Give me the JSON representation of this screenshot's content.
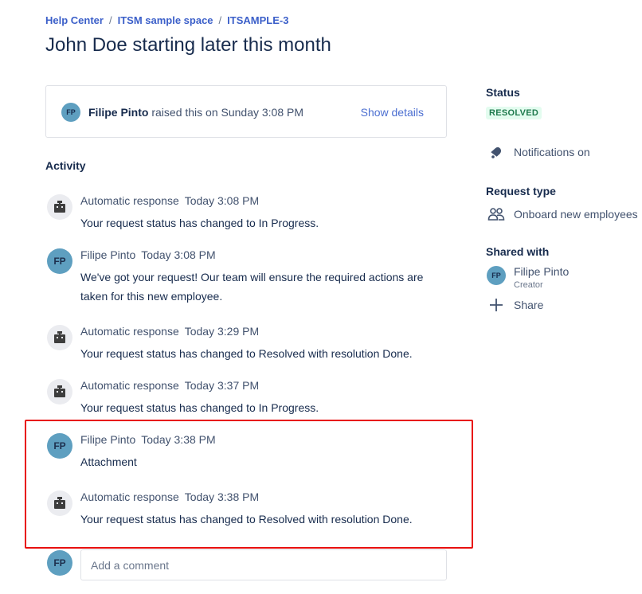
{
  "breadcrumb": {
    "items": [
      "Help Center",
      "ITSM sample space",
      "ITSAMPLE-3"
    ],
    "separator": "/"
  },
  "page_title": "John Doe starting later this month",
  "raised": {
    "initials": "FP",
    "name": "Filipe Pinto",
    "text": "raised this on Sunday 3:08 PM",
    "show_details": "Show details"
  },
  "activity": {
    "heading": "Activity",
    "items": [
      {
        "author": "Automatic response",
        "time": "Today 3:08 PM",
        "body": "Your request status has changed to In Progress.",
        "avatar": "robot-icon"
      },
      {
        "author": "Filipe Pinto",
        "time": "Today 3:08 PM",
        "body": "We've got your request! Our team will ensure the required actions are taken for this new employee.",
        "avatar": "FP"
      },
      {
        "author": "Automatic response",
        "time": "Today 3:29 PM",
        "body": "Your request status has changed to Resolved with resolution Done.",
        "avatar": "robot-icon"
      },
      {
        "author": "Automatic response",
        "time": "Today 3:37 PM",
        "body": "Your request status has changed to In Progress.",
        "avatar": "robot-icon"
      },
      {
        "author": "Filipe Pinto",
        "time": "Today 3:38 PM",
        "body": "Attachment",
        "avatar": "FP"
      },
      {
        "author": "Automatic response",
        "time": "Today 3:38 PM",
        "body": "Your request status has changed to Resolved with resolution Done.",
        "avatar": "robot-icon"
      }
    ]
  },
  "comment": {
    "initials": "FP",
    "placeholder": "Add a comment"
  },
  "sidebar": {
    "status_label": "Status",
    "status_value": "RESOLVED",
    "notifications": "Notifications on",
    "request_type_label": "Request type",
    "request_type_value": "Onboard new employees",
    "shared_with_label": "Shared with",
    "shared_user_initials": "FP",
    "shared_user_name": "Filipe Pinto",
    "shared_user_role": "Creator",
    "share_label": "Share"
  },
  "colors": {
    "link": "#3b5fc9",
    "avatar": "#5e9fc0",
    "resolved_bg": "#e3fcef",
    "resolved_fg": "#1f7a4d",
    "highlight": "#e8100f"
  }
}
